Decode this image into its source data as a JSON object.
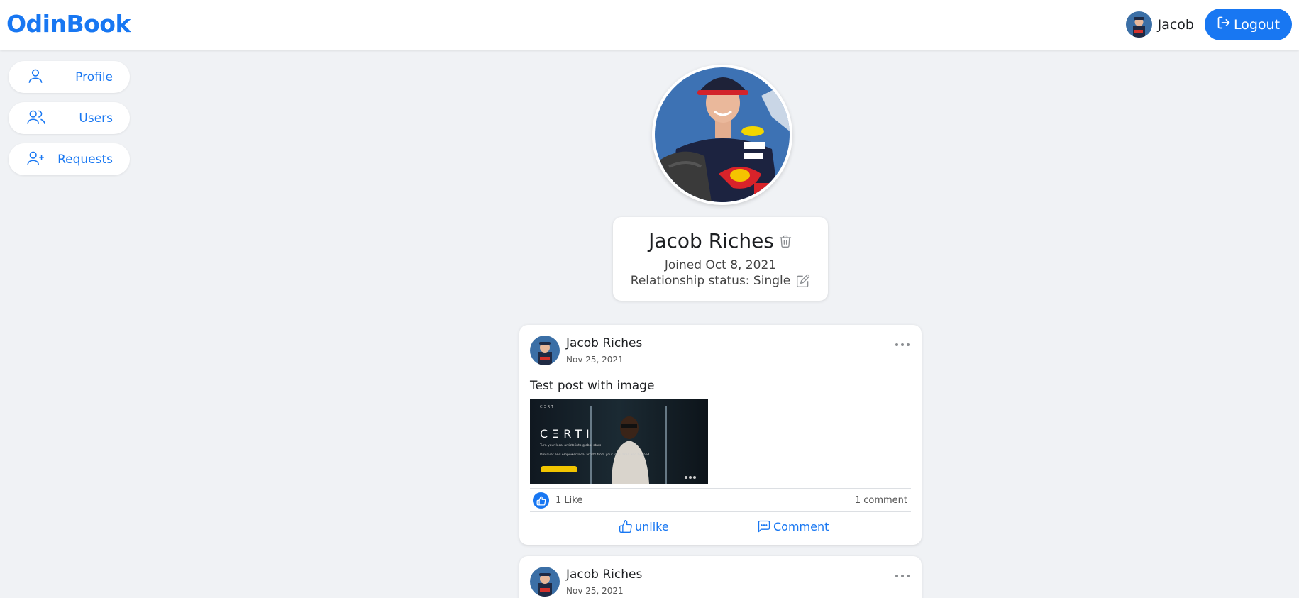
{
  "brand": {
    "name": "OdinBook",
    "color": "#1877f2"
  },
  "header": {
    "user_name": "Jacob",
    "logout_label": "Logout"
  },
  "sidebar": {
    "items": [
      {
        "label": "Profile",
        "icon": "user-icon"
      },
      {
        "label": "Users",
        "icon": "users-icon"
      },
      {
        "label": "Requests",
        "icon": "user-plus-icon"
      }
    ]
  },
  "profile": {
    "name": "Jacob Riches",
    "joined": "Joined Oct 8, 2021",
    "relationship": "Relationship status: Single"
  },
  "posts": [
    {
      "author": "Jacob Riches",
      "date": "Nov 25, 2021",
      "text": "Test post with image",
      "image": {
        "brand": "CΞRTI",
        "tagline": "Turn your local artists into global stars",
        "subtitle": "Discover and empower local artists from your local area and beyond"
      },
      "likes": "1 Like",
      "comments": "1 comment",
      "actions": {
        "like": "unlike",
        "comment": "Comment"
      }
    },
    {
      "author": "Jacob Riches",
      "date": "Nov 25, 2021"
    }
  ]
}
